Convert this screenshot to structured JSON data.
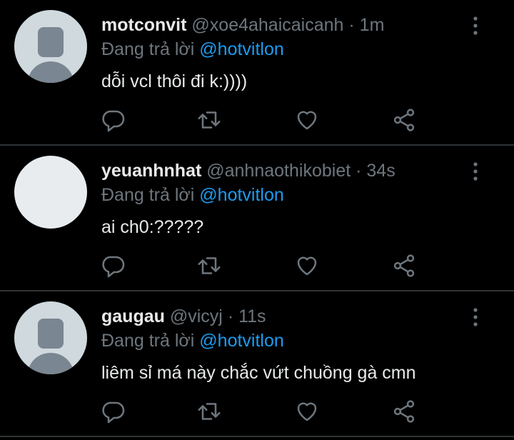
{
  "replies": [
    {
      "display_name": "motconvit",
      "handle": "@xoe4ahaicaicanh",
      "separator": "·",
      "time": "1m",
      "replying_prefix": "Đang trả lời",
      "replying_to": "@hotvitlon",
      "text": "dỗi vcl thôi đi k:))))",
      "avatar": "default-avatar"
    },
    {
      "display_name": "yeuanhnhat",
      "handle": "@anhnaothikobiet",
      "separator": "·",
      "time": "34s",
      "replying_prefix": "Đang trả lời",
      "replying_to": "@hotvitlon",
      "text": "ai ch0:?????",
      "avatar": "blank-avatar"
    },
    {
      "display_name": "gaugau",
      "handle": "@vicyj",
      "separator": "·",
      "time": "11s",
      "replying_prefix": "Đang trả lời",
      "replying_to": "@hotvitlon",
      "text": "liêm sỉ má này chắc vứt chuồng gà cmn",
      "avatar": "default-avatar"
    }
  ],
  "icons": {
    "reply": "reply-icon",
    "retweet": "retweet-icon",
    "like": "heart-icon",
    "share": "share-icon",
    "more": "more-vertical-icon"
  },
  "colors": {
    "background": "#000000",
    "text": "#e7e9ea",
    "muted": "#6e767d",
    "accent": "#1d9bf0",
    "divider": "#2f3336",
    "avatar_bg": "#cfd9de"
  }
}
